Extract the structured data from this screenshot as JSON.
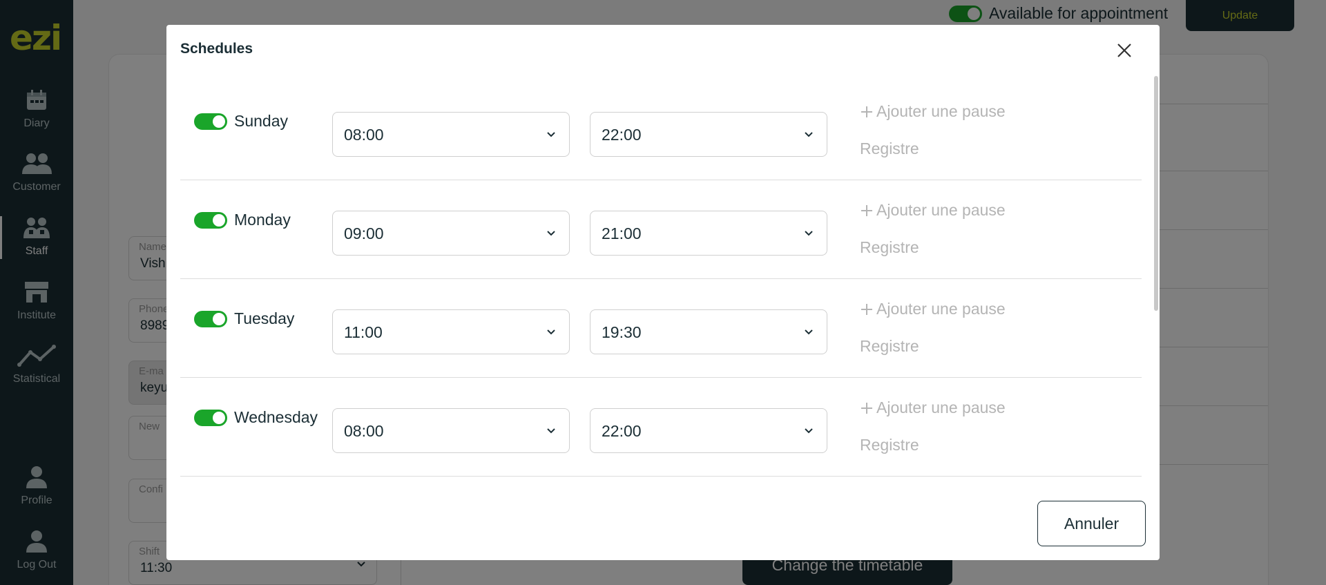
{
  "sidebar": {
    "logo": "ezi",
    "items": [
      {
        "label": "Diary",
        "icon": "calendar-icon"
      },
      {
        "label": "Customer",
        "icon": "customers-icon"
      },
      {
        "label": "Staff",
        "icon": "staff-icon",
        "active": true
      },
      {
        "label": "Institute",
        "icon": "store-icon"
      },
      {
        "label": "Statistical",
        "icon": "chart-line-icon"
      }
    ],
    "bottom_items": [
      {
        "label": "Profile",
        "icon": "user-icon"
      },
      {
        "label": "Log Out",
        "icon": "logout-user-icon"
      }
    ]
  },
  "header": {
    "available_label": "Available for appointment",
    "update_label": "Update"
  },
  "background_form": {
    "name": {
      "label": "Name",
      "value": "Vish"
    },
    "phone": {
      "label": "Phone",
      "value": "8989"
    },
    "email": {
      "label": "E-ma",
      "value": "keyu"
    },
    "new_password": {
      "label": "New"
    },
    "confirm_password": {
      "label": "Confi"
    },
    "shift": {
      "label": "Shift",
      "value": "11:30"
    },
    "change_timetable_label": "Change the timetable"
  },
  "modal": {
    "title": "Schedules",
    "add_break_label": "Ajouter une pause",
    "register_label": "Registre",
    "cancel_label": "Annuler",
    "days": [
      {
        "name": "Sunday",
        "enabled": true,
        "start": "08:00",
        "end": "22:00"
      },
      {
        "name": "Monday",
        "enabled": true,
        "start": "09:00",
        "end": "21:00"
      },
      {
        "name": "Tuesday",
        "enabled": true,
        "start": "11:00",
        "end": "19:30"
      },
      {
        "name": "Wednesday",
        "enabled": true,
        "start": "08:00",
        "end": "22:00"
      }
    ]
  },
  "colors": {
    "sidebar_bg": "#1b2e35",
    "brand_accent": "#c9d42b",
    "toggle_on": "#1aa52a",
    "muted_text": "#b4b4b4"
  }
}
